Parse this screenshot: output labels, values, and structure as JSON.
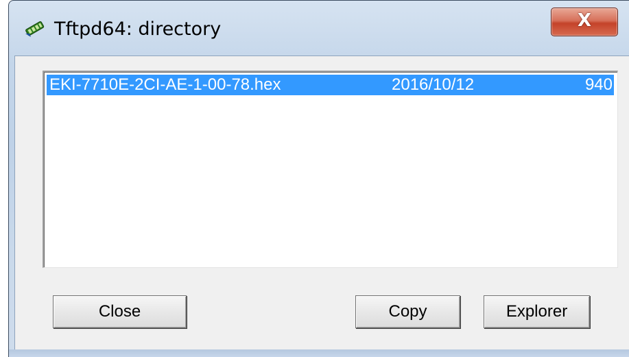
{
  "window": {
    "title": "Tftpd64: directory",
    "close_glyph": "X",
    "icon": "tftpd-app-icon"
  },
  "file_list": {
    "rows": [
      {
        "name": "EKI-7710E-2CI-AE-1-00-78.hex",
        "date": "2016/10/12",
        "size": "940",
        "selected": true
      }
    ],
    "selection_color": "#3399ff"
  },
  "buttons": {
    "close_label": "Close",
    "copy_label": "Copy",
    "explorer_label": "Explorer"
  },
  "colors": {
    "titlebar_close_button": "#c4432a",
    "dialog_background": "#f0f0f0"
  }
}
